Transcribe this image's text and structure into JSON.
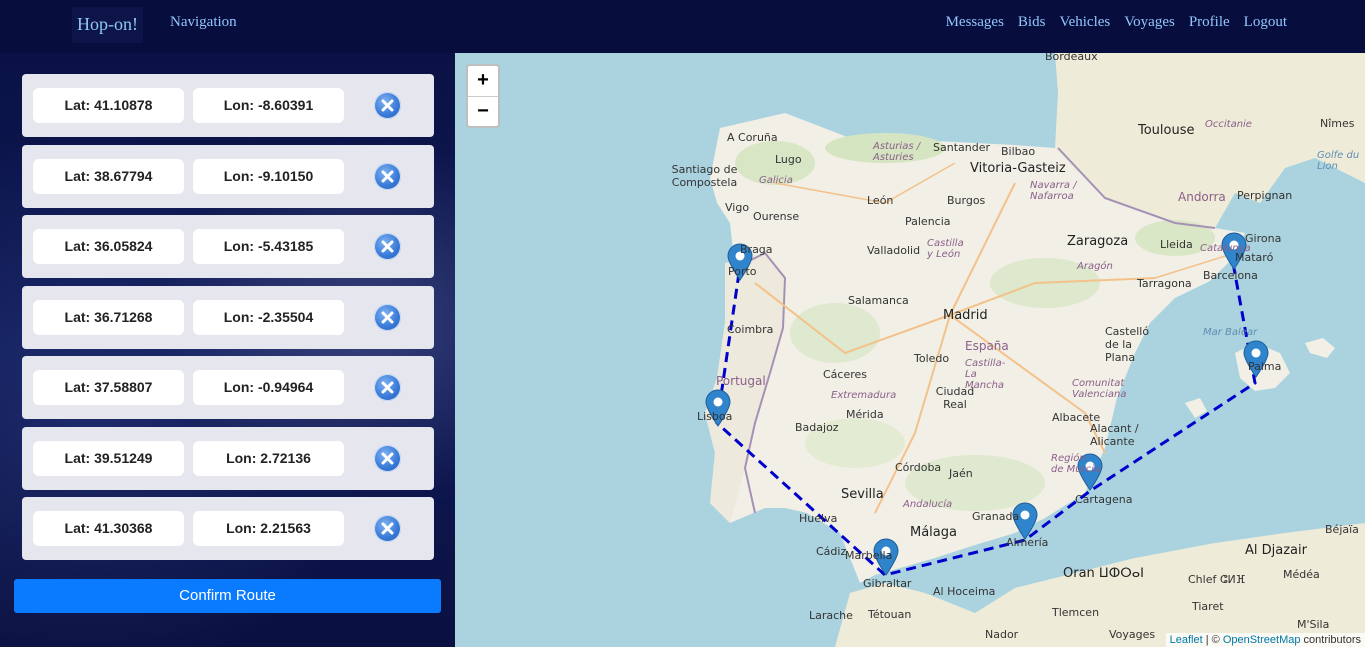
{
  "navbar": {
    "brand": "Hop-on!",
    "navigation": "Navigation",
    "links": [
      "Messages",
      "Bids",
      "Vehicles",
      "Voyages",
      "Profile",
      "Logout"
    ]
  },
  "route_points": [
    {
      "lat": "Lat: 41.10878",
      "lon": "Lon: -8.60391"
    },
    {
      "lat": "Lat: 38.67794",
      "lon": "Lon: -9.10150"
    },
    {
      "lat": "Lat: 36.05824",
      "lon": "Lon: -5.43185"
    },
    {
      "lat": "Lat: 36.71268",
      "lon": "Lon: -2.35504"
    },
    {
      "lat": "Lat: 37.58807",
      "lon": "Lon: -0.94964"
    },
    {
      "lat": "Lat: 39.51249",
      "lon": "Lon: 2.72136"
    },
    {
      "lat": "Lat: 41.30368",
      "lon": "Lon: 2.21563"
    }
  ],
  "confirm_label": "Confirm Route",
  "map": {
    "zoom_in": "+",
    "zoom_out": "−",
    "attribution_leaflet": "Leaflet",
    "attribution_sep": " | © ",
    "attribution_osm": "OpenStreetMap",
    "attribution_tail": " contributors",
    "route_color": "#0000cc",
    "marker_color": "#2f84cc",
    "labels": {
      "bordeaux": "Bordeaux",
      "toulouse": "Toulouse",
      "occitanie": "Occitanie",
      "nimes": "Nîmes",
      "acoruna": "A Coruña",
      "lugo": "Lugo",
      "asturias": "Asturias / Asturies",
      "santander": "Santander",
      "bilbao": "Bilbao",
      "vitoria": "Vitoria-Gasteiz",
      "santiago": "Santiago de Compostela",
      "galicia": "Galicia",
      "navarra": "Navarra / Nafarroa",
      "andorra": "Andorra",
      "perpignan": "Perpignan",
      "golfe": "Golfe du Lion",
      "vigo": "Vigo",
      "ourense": "Ourense",
      "leon": "León",
      "burgos": "Burgos",
      "palencia": "Palencia",
      "zaragoza": "Zaragoza",
      "lleida": "Lleida",
      "girona": "Girona",
      "braga": "Braga",
      "porto": "Porto",
      "valladolid": "Valladolid",
      "castilla": "Castilla y León",
      "catalunya": "Catalunya",
      "mataro": "Mataró",
      "barcelona": "Barcelona",
      "aragon": "Aragón",
      "tarragona": "Tarragona",
      "salamanca": "Salamanca",
      "madrid": "Madrid",
      "coimbra": "Coimbra",
      "marbalear": "Mar Balear",
      "castello": "Castelló de la Plana",
      "espana": "España",
      "toledo": "Toledo",
      "castillamancha": "Castilla-La Mancha",
      "portugal": "Portugal",
      "caceres": "Cáceres",
      "palma": "Palma",
      "comunitat": "Comunitat Valenciana",
      "lisboa": "Lisboa",
      "ciudadreal": "Ciudad Real",
      "extremadura": "Extremadura",
      "merida": "Mérida",
      "albacete": "Albacete",
      "badajoz": "Badajoz",
      "alicant": "Alacant / Alicante",
      "murcia": "Región de Murcia",
      "cordoba": "Córdoba",
      "jaen": "Jaén",
      "sevilla": "Sevilla",
      "andalucia": "Andalucía",
      "cartagena": "Cartagena",
      "huelva": "Huelva",
      "granada": "Granada",
      "malaga": "Málaga",
      "almeria": "Almería",
      "bejaia": "Béjaïa",
      "cadiz": "Cádiz",
      "marbella": "Marbella",
      "aldjazair": "Al Djazair",
      "gibraltar": "Gibraltar",
      "oran": "Oran ⵡⵀⵔⴰⵏ",
      "alhoceima": "Al Hoceima",
      "chlef": "Chlef ⵛⵍⴼ",
      "medea": "Médéa",
      "tetouan": "Tétouan",
      "larache": "Larache",
      "tiaret": "Tiaret",
      "tlemcen": "Tlemcen",
      "nador": "Nador",
      "voyages": "Voyages",
      "msila": "M'Sila"
    }
  }
}
